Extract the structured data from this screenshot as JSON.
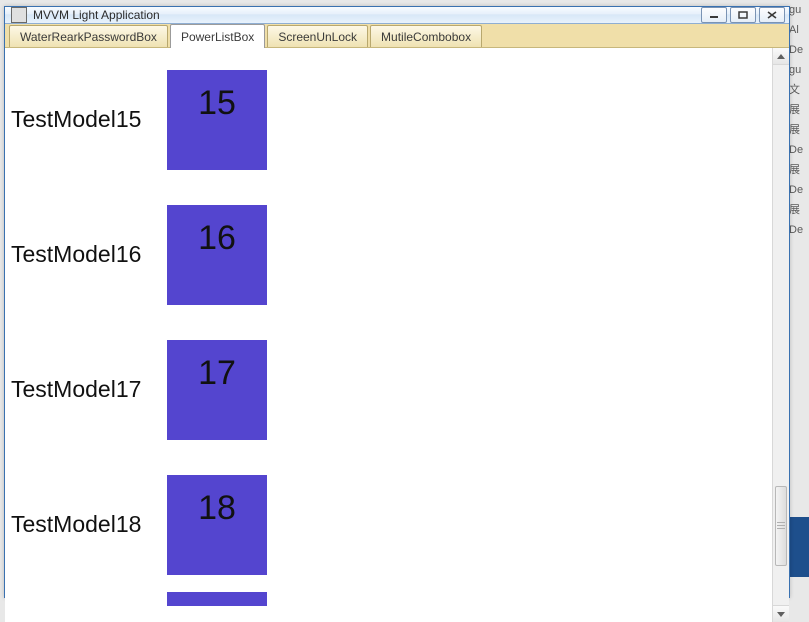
{
  "window": {
    "title": "MVVM Light Application"
  },
  "tabs": [
    {
      "label": "WaterRearkPasswordBox",
      "active": false
    },
    {
      "label": "PowerListBox",
      "active": true
    },
    {
      "label": "ScreenUnLock",
      "active": false
    },
    {
      "label": "MutileCombobox",
      "active": false
    }
  ],
  "list": {
    "items": [
      {
        "label": "TestModel15",
        "value": "15"
      },
      {
        "label": "TestModel16",
        "value": "16"
      },
      {
        "label": "TestModel17",
        "value": "17"
      },
      {
        "label": "TestModel18",
        "value": "18"
      }
    ]
  },
  "colors": {
    "tile_bg": "#5445cf",
    "tabstrip_bg": "#f0dfa9",
    "window_border": "#3a71b0"
  },
  "background_text_fragments": [
    "gu",
    "Al",
    "De",
    "",
    "gu",
    "文",
    "展",
    "展",
    "",
    "De",
    "展",
    "",
    "De",
    "",
    "",
    "展",
    "De"
  ]
}
